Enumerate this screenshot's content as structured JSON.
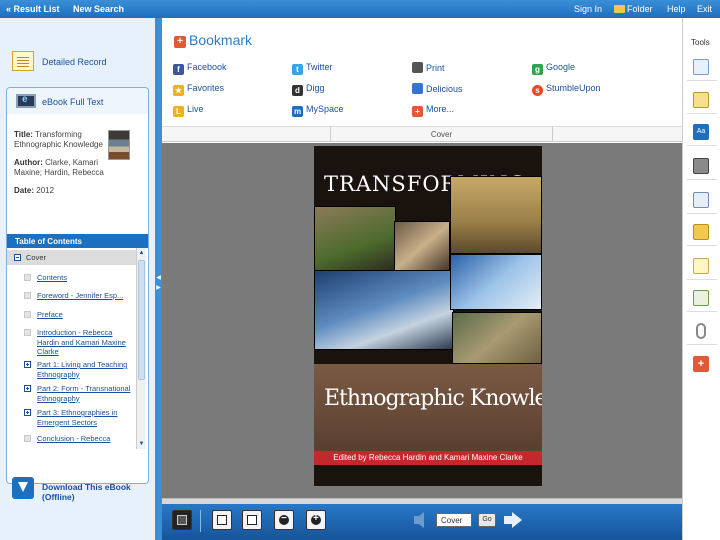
{
  "topbar": {
    "result_list": "« Result List",
    "new_search": "New Search",
    "sign_in": "Sign In",
    "folder": "Folder",
    "help": "Help",
    "exit": "Exit"
  },
  "left": {
    "detailed_record": "Detailed Record",
    "ebook_full_text": "eBook Full Text",
    "title_label": "Title:",
    "title_value": "Transforming Ethnographic Knowledge",
    "author_label": "Author:",
    "author_value": "Clarke, Kamari Maxine; Hardin, Rebecca",
    "date_label": "Date:",
    "date_value": "2012",
    "toc_header": "Table of Contents",
    "toc_items": [
      "Cover",
      "Contents",
      "Foreword - Jennifer Esp...",
      "Preface",
      "Introduction - Rebecca Hardin and Kamari Maxine Clarke",
      "Part 1: Living and Teaching Ethnography",
      "Part 2: Form - Transnational Ethnography",
      "Part 3: Ethnographies in Emergent Sectors",
      "Conclusion - Rebecca"
    ],
    "download_label": "Download This eBook (Offline)"
  },
  "bookmark": {
    "title": "Bookmark",
    "items": [
      {
        "label": "Facebook",
        "icon": "facebook-icon",
        "color": "#3b5998"
      },
      {
        "label": "Twitter",
        "icon": "twitter-icon",
        "color": "#3aa3e3"
      },
      {
        "label": "Print",
        "icon": "print-icon",
        "color": "#555555"
      },
      {
        "label": "Google",
        "icon": "google-icon",
        "color": "#2fa44f"
      },
      {
        "label": "Favorites",
        "icon": "star-icon",
        "color": "#f2b01e"
      },
      {
        "label": "Digg",
        "icon": "digg-icon",
        "color": "#333333"
      },
      {
        "label": "Delicious",
        "icon": "delicious-icon",
        "color": "#3274d2"
      },
      {
        "label": "StumbleUpon",
        "icon": "stumbleupon-icon",
        "color": "#eb4924"
      },
      {
        "label": "Live",
        "icon": "live-icon",
        "color": "#f2b01e"
      },
      {
        "label": "MySpace",
        "icon": "myspace-icon",
        "color": "#1b6ec2"
      },
      {
        "label": "More...",
        "icon": "more-icon",
        "color": "#e05a35"
      }
    ]
  },
  "viewer": {
    "page_label": "Cover",
    "book_title": "TRANSFORMING",
    "book_subtitle": "Ethnographic Knowledge",
    "book_editors": "Edited by Rebecca Hardin and Kamari Maxine Clarke",
    "page_input": "Cover",
    "go_label": "Go"
  },
  "tools": {
    "header": "Tools"
  }
}
